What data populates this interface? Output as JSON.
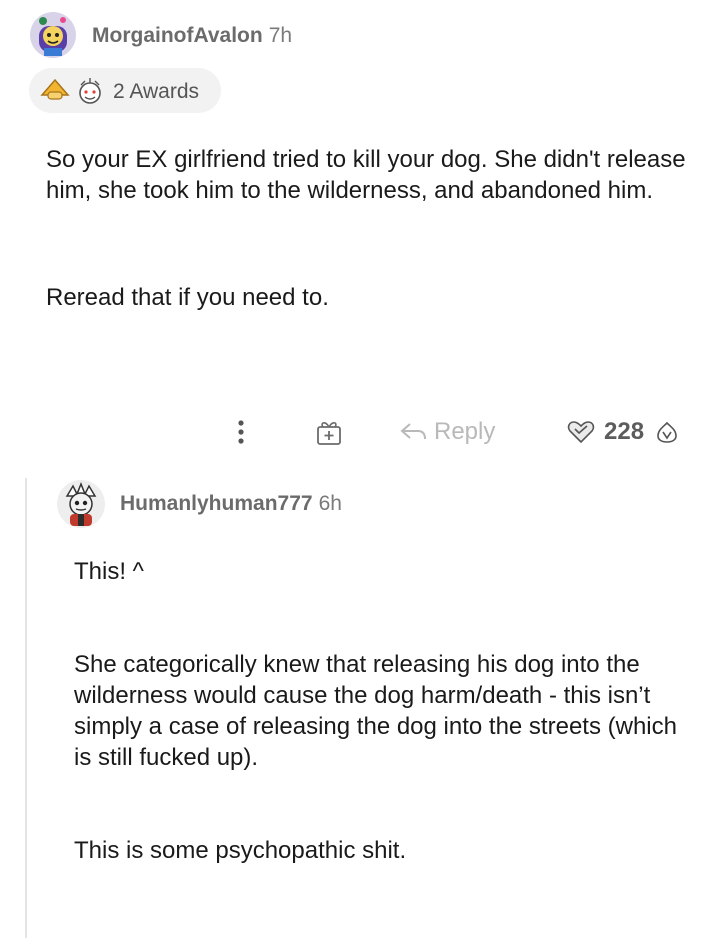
{
  "comment": {
    "author": "MorgainofAvalon",
    "time": "7h",
    "awards_label": "2 Awards",
    "award_icons": [
      "gold-hands-icon",
      "wholesome-award-icon"
    ],
    "paragraphs": [
      "So your EX girlfriend tried to kill your dog. She didn't release him, she took him to the wilderness, and abandoned him.",
      "Reread that if you need to."
    ],
    "actions": {
      "more_icon": "more-vertical-icon",
      "award_icon": "gift-icon",
      "reply_label": "Reply",
      "score": "228"
    }
  },
  "reply": {
    "author": "Humanlyhuman777",
    "time": "6h",
    "paragraphs": [
      "This! ^",
      "She categorically knew that releasing his dog into the wilderness would cause the dog harm/death - this isn’t simply a case of releasing the dog into the streets (which is still fucked up).",
      "This is some psychopathic shit."
    ]
  },
  "colors": {
    "text": "#1a1a1b",
    "meta": "#6b6b6b",
    "muted": "#b9b9b9",
    "pill_bg": "#f2f2f2",
    "thread_line": "#e4e4e4"
  }
}
